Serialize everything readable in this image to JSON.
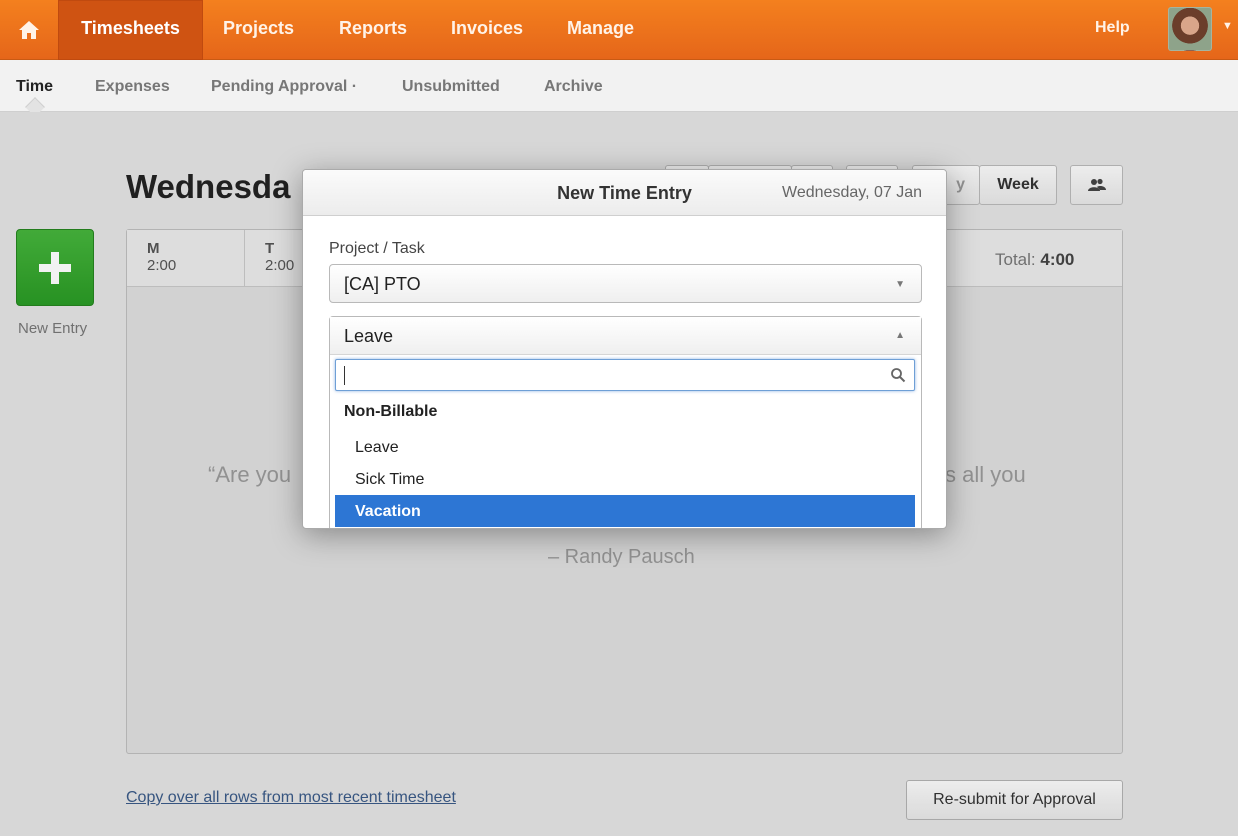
{
  "topnav": {
    "items": [
      {
        "label": "Timesheets",
        "active": true
      },
      {
        "label": "Projects"
      },
      {
        "label": "Reports"
      },
      {
        "label": "Invoices"
      },
      {
        "label": "Manage"
      }
    ],
    "help": "Help"
  },
  "subnav": {
    "items": [
      {
        "label": "Time",
        "active": true
      },
      {
        "label": "Expenses"
      },
      {
        "label": "Pending Approval ·"
      },
      {
        "label": "Unsubmitted"
      },
      {
        "label": "Archive"
      }
    ]
  },
  "page": {
    "title_fragment": "Wednesda",
    "week_button": "Week",
    "day_button_fragment": "y",
    "new_entry": "New Entry",
    "days": [
      {
        "day": "M",
        "hours": "2:00"
      },
      {
        "day": "T",
        "hours": "2:00"
      }
    ],
    "total_label": "Total: ",
    "total_value": "4:00",
    "quote_left": "“Are you",
    "quote_right": "s all you",
    "quote_author": "– Randy Pausch",
    "copy_link": "Copy over all rows from most recent timesheet",
    "resubmit": "Re-submit for Approval"
  },
  "modal": {
    "title": "New Time Entry",
    "date": "Wednesday, 07 Jan",
    "project_label": "Project / Task",
    "project_value": "[CA] PTO",
    "task_value": "Leave",
    "search_value": "",
    "group_label": "Non-Billable",
    "options": [
      "Leave",
      "Sick Time",
      "Vacation"
    ],
    "selected_option": "Vacation"
  },
  "colors": {
    "brand_orange": "#e8691a",
    "active_nav": "#cf5312",
    "new_entry_green": "#2fa02a",
    "selection_blue": "#2d76d4"
  }
}
